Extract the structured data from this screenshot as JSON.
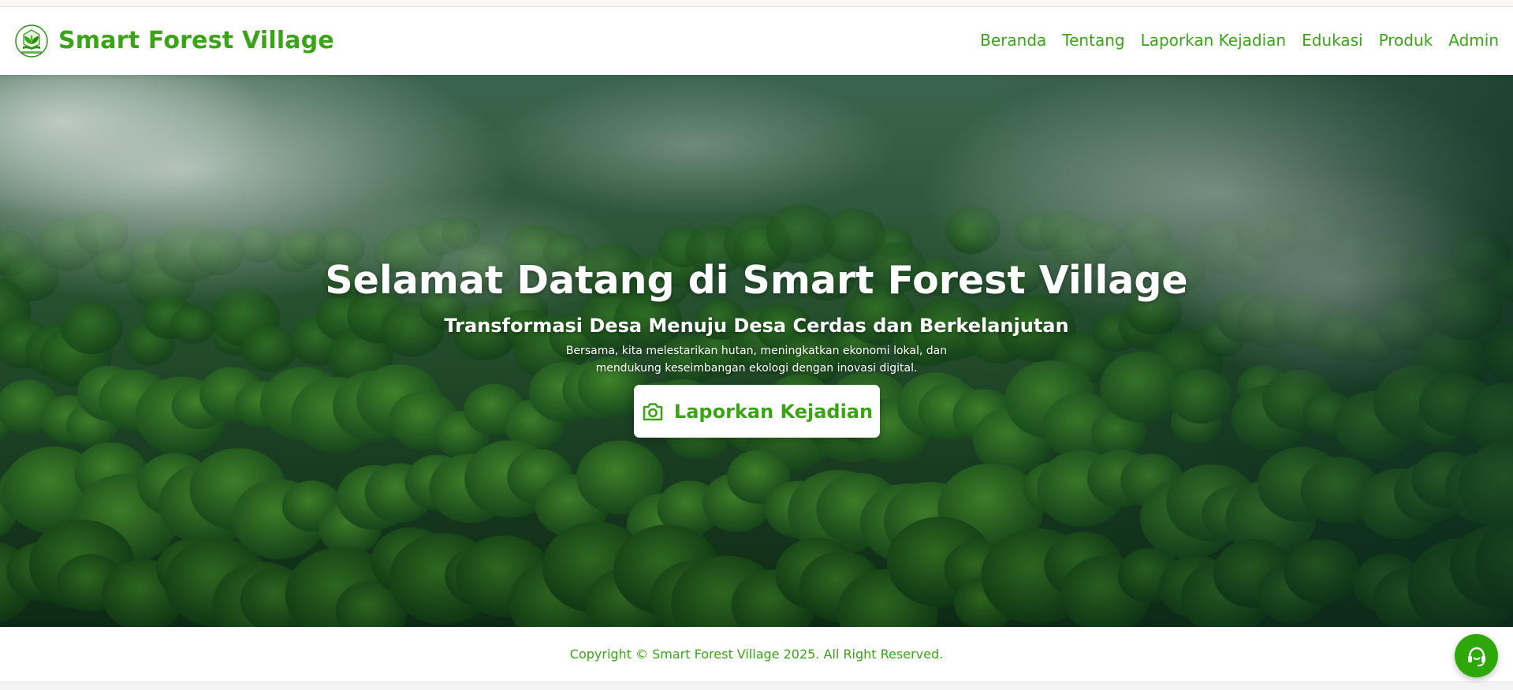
{
  "brand": {
    "title": "Smart Forest Village",
    "logo": "leaf-book-logo-icon",
    "logo_caption": "Smart Forest Village"
  },
  "nav": {
    "items": [
      "Beranda",
      "Tentang",
      "Laporkan Kejadian",
      "Edukasi",
      "Produk",
      "Admin"
    ]
  },
  "hero": {
    "background": "misty-forest-canopy",
    "title": "Selamat Datang di Smart Forest Village",
    "subtitle": "Transformasi Desa Menuju Desa Cerdas dan Berkelanjutan",
    "description": "Bersama, kita melestarikan hutan, meningkatkan ekonomi lokal, dan mendukung keseimbangan ekologi dengan inovasi digital.",
    "cta": {
      "label": "Laporkan Kejadian",
      "icon": "camera-icon"
    }
  },
  "footer": {
    "copyright": "Copyright © Smart Forest Village 2025. All Right Reserved."
  },
  "support": {
    "icon": "customer-support-icon"
  },
  "colors": {
    "brand_green": "#3ba318",
    "support_button": "#2ea70a",
    "hero_text": "#ffffff",
    "navbar_bg": "#ffffff"
  }
}
